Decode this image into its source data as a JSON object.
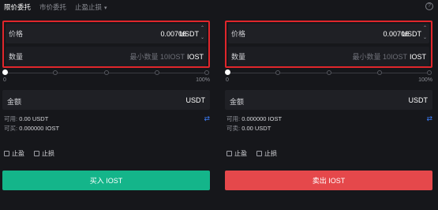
{
  "tabs": [
    {
      "label": "限价委托",
      "active": true
    },
    {
      "label": "市价委托",
      "active": false
    },
    {
      "label": "止盈止损",
      "active": false,
      "has_dropdown": true
    }
  ],
  "help_icon": "?",
  "buy": {
    "price_label": "价格",
    "price_value": "0.00706",
    "price_unit": "USDT",
    "qty_label": "数量",
    "qty_placeholder": "最小数量 10IOST",
    "qty_unit": "IOST",
    "slider_min": "0",
    "slider_max": "100%",
    "slider_percent": 0,
    "amount_label": "金额",
    "amount_unit": "USDT",
    "available_label": "可用:",
    "available_value": "0.00 USDT",
    "can_buy_label": "可买:",
    "can_buy_value": "0.000000 IOST",
    "take_profit": "止盈",
    "stop_loss": "止损",
    "action": "买入 IOST"
  },
  "sell": {
    "price_label": "价格",
    "price_value": "0.00706",
    "price_unit": "USDT",
    "qty_label": "数量",
    "qty_placeholder": "最小数量 10IOST",
    "qty_unit": "IOST",
    "slider_min": "0",
    "slider_max": "100%",
    "slider_percent": 0,
    "amount_label": "金额",
    "amount_unit": "USDT",
    "available_label": "可用:",
    "available_value": "0.000000 IOST",
    "can_sell_label": "可卖:",
    "can_sell_value": "0.00 USDT",
    "take_profit": "止盈",
    "stop_loss": "止损",
    "action": "卖出 IOST"
  },
  "colors": {
    "buy": "#14b58a",
    "sell": "#e5484b",
    "highlight_border": "#e0262b",
    "accent": "#3b7bf5"
  }
}
